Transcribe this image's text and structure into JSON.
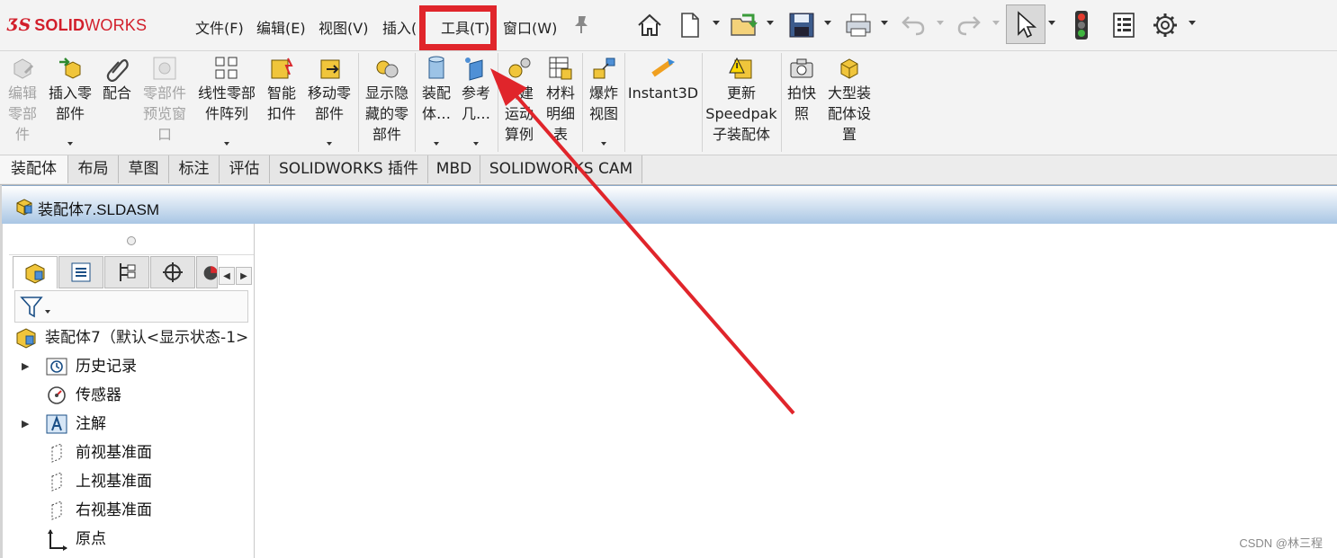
{
  "app": {
    "logo_ds": "ƷS",
    "logo_solid": "SOLID",
    "logo_works": "WORKS",
    "brand_color": "#d21f2b"
  },
  "menu": [
    "文件(F)",
    "编辑(E)",
    "视图(V)",
    "插入(",
    "工具(T)",
    "窗口(W)"
  ],
  "quick_toolbar": [
    "home-icon",
    "new-document-icon",
    "open-folder-icon",
    "save-icon",
    "print-icon",
    "undo-icon",
    "redo-icon",
    "select-pointer-icon",
    "rebuild-traffic-light-icon",
    "file-properties-icon",
    "options-gear-icon"
  ],
  "ribbon": {
    "buttons": [
      {
        "label": "编辑\n零部\n件",
        "disabled": true
      },
      {
        "label": "插入零\n部件",
        "disabled": false
      },
      {
        "label": "配合",
        "disabled": false
      },
      {
        "label": "零部件\n预览窗\n口",
        "disabled": true
      },
      {
        "label": "线性零部\n件阵列",
        "disabled": false
      },
      {
        "label": "智能\n扣件",
        "disabled": false
      },
      {
        "label": "移动零\n部件",
        "disabled": false
      },
      {
        "label": "显示隐\n藏的零\n部件",
        "disabled": false
      },
      {
        "label": "装配\n体…",
        "disabled": false
      },
      {
        "label": "参考\n几…",
        "disabled": false
      },
      {
        "label": "新建\n运动\n算例",
        "disabled": false
      },
      {
        "label": "材料\n明细\n表",
        "disabled": false
      },
      {
        "label": "爆炸\n视图",
        "disabled": false
      },
      {
        "label": "Instant3D",
        "disabled": false
      },
      {
        "label": "更新\nSpeedpak\n子装配体",
        "disabled": false
      },
      {
        "label": "拍快\n照",
        "disabled": false
      },
      {
        "label": "大型装\n配体设\n置",
        "disabled": false
      }
    ]
  },
  "tabs": [
    "装配体",
    "布局",
    "草图",
    "标注",
    "评估",
    "SOLIDWORKS 插件",
    "MBD",
    "SOLIDWORKS CAM"
  ],
  "document": {
    "title": "装配体7.SLDASM"
  },
  "feature_tree": {
    "root": "装配体7（默认<显示状态-1>",
    "items": [
      {
        "label": "历史记录",
        "expandable": true,
        "icon": "history-icon"
      },
      {
        "label": "传感器",
        "expandable": false,
        "icon": "sensor-icon"
      },
      {
        "label": "注解",
        "expandable": true,
        "icon": "annotation-icon"
      },
      {
        "label": "前视基准面",
        "expandable": false,
        "icon": "plane-icon"
      },
      {
        "label": "上视基准面",
        "expandable": false,
        "icon": "plane-icon"
      },
      {
        "label": "右视基准面",
        "expandable": false,
        "icon": "plane-icon"
      },
      {
        "label": "原点",
        "expandable": false,
        "icon": "origin-icon"
      }
    ]
  },
  "watermark": "CSDN @林三程",
  "annotation": {
    "highlight_color": "#e0252b",
    "highlighted_menu": "工具(T)"
  }
}
